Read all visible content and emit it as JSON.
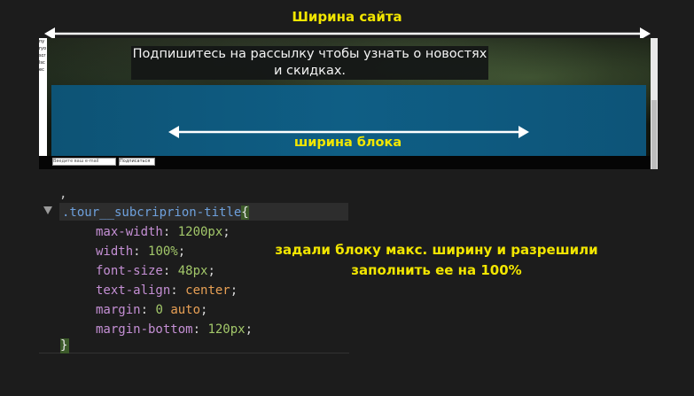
{
  "annotations": {
    "site_width": "Ширина сайта",
    "block_width": "ширина блока",
    "note_line1": "задали блоку макс. ширину и разрешили",
    "note_line2": "заполнить ее на 100%",
    "color": "#f2e600",
    "arrow_color": "#ffffff"
  },
  "preview": {
    "title": "Подпишитесь на рассылку чтобы узнать о новостях и скидках.",
    "left_strip_text": [
      "ny",
      "ryo",
      "scr",
      "lsc",
      "ec"
    ],
    "email_placeholder": "Введите ваш e-mail",
    "subscribe_label": "Подписаться",
    "band_color": "#0f5e85"
  },
  "code": {
    "brace_above": ",",
    "selector": ".tour__subcriprion-title",
    "open_brace": "{",
    "close_brace": "}",
    "declarations": [
      {
        "prop": "max-width",
        "value": "1200px",
        "kind": "num"
      },
      {
        "prop": "width",
        "value": "100%",
        "kind": "num"
      },
      {
        "prop": "font-size",
        "value": "48px",
        "kind": "num"
      },
      {
        "prop": "text-align",
        "value": "center",
        "kind": "kw"
      },
      {
        "prop": "margin",
        "value_num": "0",
        "value_kw": "auto",
        "kind": "mixed"
      },
      {
        "prop": "margin-bottom",
        "value": "120px",
        "kind": "num"
      }
    ]
  }
}
